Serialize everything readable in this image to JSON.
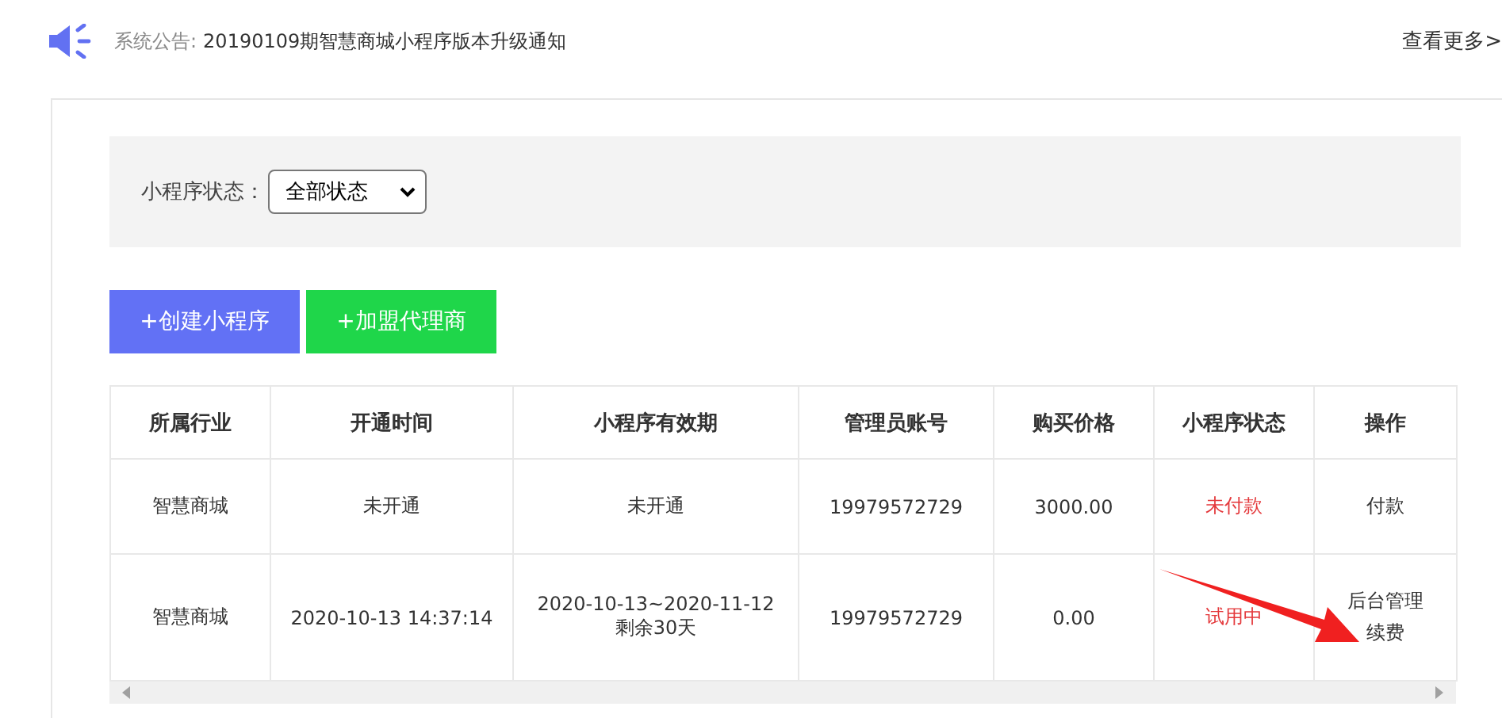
{
  "notice": {
    "label": "系统公告:",
    "text": "20190109期智慧商城小程序版本升级通知",
    "more": "查看更多>"
  },
  "filter": {
    "label": "小程序状态：",
    "value": "全部状态"
  },
  "buttons": [
    {
      "label": "+创建小程序",
      "kind": "primary"
    },
    {
      "label": "+加盟代理商",
      "kind": "success"
    }
  ],
  "table": {
    "columns": [
      "所属行业",
      "开通时间",
      "小程序有效期",
      "管理员账号",
      "购买价格",
      "小程序状态",
      "操作"
    ],
    "rows": [
      {
        "industry": "智慧商城",
        "opened": "未开通",
        "validity": [
          "未开通"
        ],
        "account": "19979572729",
        "price": "3000.00",
        "status": {
          "text": "未付款",
          "color": "#e4393c"
        },
        "actions": [
          "付款"
        ]
      },
      {
        "industry": "智慧商城",
        "opened": "2020-10-13 14:37:14",
        "validity": [
          "2020-10-13~2020-11-12",
          "剩余30天"
        ],
        "account": "19979572729",
        "price": "0.00",
        "status": {
          "text": "试用中",
          "color": "#e4393c"
        },
        "actions": [
          "后台管理",
          "续费"
        ]
      }
    ]
  }
}
